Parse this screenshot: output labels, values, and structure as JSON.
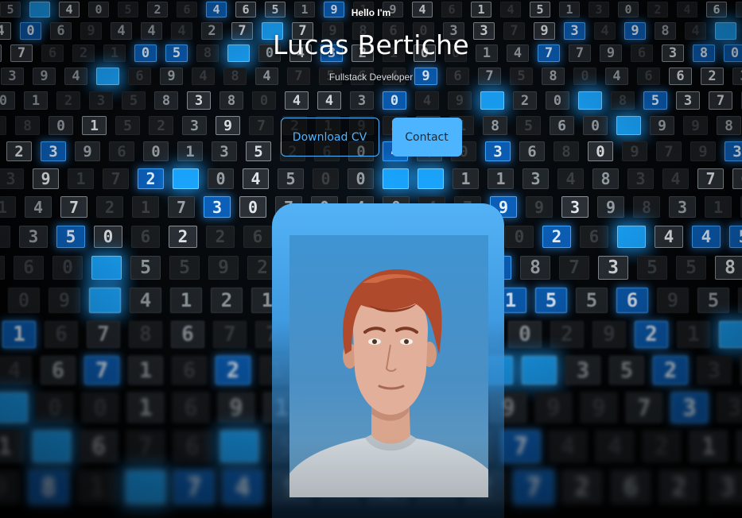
{
  "hero": {
    "greeting": "Hello I'm",
    "name": "Lucas Bertiche",
    "role": "Fullstack Developer"
  },
  "actions": {
    "download_cv_label": "Download CV",
    "contact_label": "Contact"
  },
  "colors": {
    "accent": "#4db5ff",
    "text": "#ffffff",
    "background": "#050607"
  },
  "portrait": {
    "icon": "person-photo"
  }
}
